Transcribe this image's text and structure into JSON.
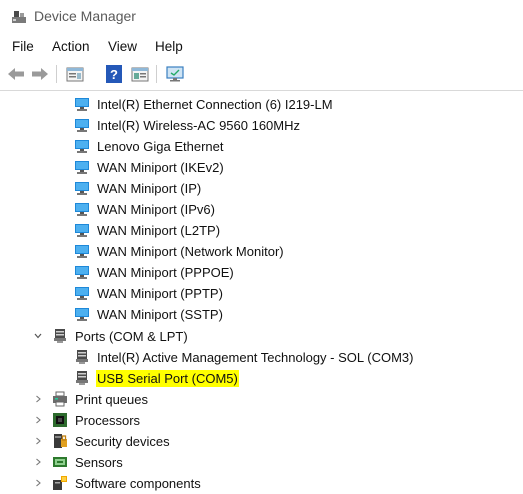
{
  "window": {
    "title": "Device Manager"
  },
  "menu": [
    "File",
    "Action",
    "View",
    "Help"
  ],
  "toolbar": {
    "buttons": [
      "back-icon",
      "forward-icon",
      "properties-icon",
      "help-icon",
      "run-icon",
      "scan-hardware-icon"
    ]
  },
  "tree": {
    "network_adapters": [
      "Intel(R) Ethernet Connection (6) I219-LM",
      "Intel(R) Wireless-AC 9560 160MHz",
      "Lenovo Giga Ethernet",
      "WAN Miniport (IKEv2)",
      "WAN Miniport (IP)",
      "WAN Miniport (IPv6)",
      "WAN Miniport (L2TP)",
      "WAN Miniport (Network Monitor)",
      "WAN Miniport (PPPOE)",
      "WAN Miniport (PPTP)",
      "WAN Miniport (SSTP)"
    ],
    "ports": {
      "label": "Ports (COM & LPT)",
      "children": [
        "Intel(R) Active Management Technology - SOL (COM3)",
        "USB Serial Port (COM5)"
      ]
    },
    "categories": [
      "Print queues",
      "Processors",
      "Security devices",
      "Sensors",
      "Software components"
    ]
  },
  "colors": {
    "highlight": "#ffff00",
    "network_icon": "#1e88d8"
  }
}
